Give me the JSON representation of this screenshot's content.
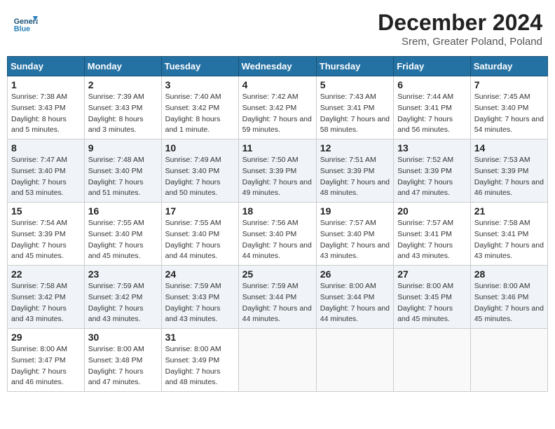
{
  "header": {
    "logo_general": "General",
    "logo_blue": "Blue",
    "month_title": "December 2024",
    "location": "Srem, Greater Poland, Poland"
  },
  "calendar": {
    "days_of_week": [
      "Sunday",
      "Monday",
      "Tuesday",
      "Wednesday",
      "Thursday",
      "Friday",
      "Saturday"
    ],
    "weeks": [
      [
        {
          "day": "1",
          "sunrise": "7:38 AM",
          "sunset": "3:43 PM",
          "daylight": "8 hours and 5 minutes."
        },
        {
          "day": "2",
          "sunrise": "7:39 AM",
          "sunset": "3:43 PM",
          "daylight": "8 hours and 3 minutes."
        },
        {
          "day": "3",
          "sunrise": "7:40 AM",
          "sunset": "3:42 PM",
          "daylight": "8 hours and 1 minute."
        },
        {
          "day": "4",
          "sunrise": "7:42 AM",
          "sunset": "3:42 PM",
          "daylight": "7 hours and 59 minutes."
        },
        {
          "day": "5",
          "sunrise": "7:43 AM",
          "sunset": "3:41 PM",
          "daylight": "7 hours and 58 minutes."
        },
        {
          "day": "6",
          "sunrise": "7:44 AM",
          "sunset": "3:41 PM",
          "daylight": "7 hours and 56 minutes."
        },
        {
          "day": "7",
          "sunrise": "7:45 AM",
          "sunset": "3:40 PM",
          "daylight": "7 hours and 54 minutes."
        }
      ],
      [
        {
          "day": "8",
          "sunrise": "7:47 AM",
          "sunset": "3:40 PM",
          "daylight": "7 hours and 53 minutes."
        },
        {
          "day": "9",
          "sunrise": "7:48 AM",
          "sunset": "3:40 PM",
          "daylight": "7 hours and 51 minutes."
        },
        {
          "day": "10",
          "sunrise": "7:49 AM",
          "sunset": "3:40 PM",
          "daylight": "7 hours and 50 minutes."
        },
        {
          "day": "11",
          "sunrise": "7:50 AM",
          "sunset": "3:39 PM",
          "daylight": "7 hours and 49 minutes."
        },
        {
          "day": "12",
          "sunrise": "7:51 AM",
          "sunset": "3:39 PM",
          "daylight": "7 hours and 48 minutes."
        },
        {
          "day": "13",
          "sunrise": "7:52 AM",
          "sunset": "3:39 PM",
          "daylight": "7 hours and 47 minutes."
        },
        {
          "day": "14",
          "sunrise": "7:53 AM",
          "sunset": "3:39 PM",
          "daylight": "7 hours and 46 minutes."
        }
      ],
      [
        {
          "day": "15",
          "sunrise": "7:54 AM",
          "sunset": "3:39 PM",
          "daylight": "7 hours and 45 minutes."
        },
        {
          "day": "16",
          "sunrise": "7:55 AM",
          "sunset": "3:40 PM",
          "daylight": "7 hours and 45 minutes."
        },
        {
          "day": "17",
          "sunrise": "7:55 AM",
          "sunset": "3:40 PM",
          "daylight": "7 hours and 44 minutes."
        },
        {
          "day": "18",
          "sunrise": "7:56 AM",
          "sunset": "3:40 PM",
          "daylight": "7 hours and 44 minutes."
        },
        {
          "day": "19",
          "sunrise": "7:57 AM",
          "sunset": "3:40 PM",
          "daylight": "7 hours and 43 minutes."
        },
        {
          "day": "20",
          "sunrise": "7:57 AM",
          "sunset": "3:41 PM",
          "daylight": "7 hours and 43 minutes."
        },
        {
          "day": "21",
          "sunrise": "7:58 AM",
          "sunset": "3:41 PM",
          "daylight": "7 hours and 43 minutes."
        }
      ],
      [
        {
          "day": "22",
          "sunrise": "7:58 AM",
          "sunset": "3:42 PM",
          "daylight": "7 hours and 43 minutes."
        },
        {
          "day": "23",
          "sunrise": "7:59 AM",
          "sunset": "3:42 PM",
          "daylight": "7 hours and 43 minutes."
        },
        {
          "day": "24",
          "sunrise": "7:59 AM",
          "sunset": "3:43 PM",
          "daylight": "7 hours and 43 minutes."
        },
        {
          "day": "25",
          "sunrise": "7:59 AM",
          "sunset": "3:44 PM",
          "daylight": "7 hours and 44 minutes."
        },
        {
          "day": "26",
          "sunrise": "8:00 AM",
          "sunset": "3:44 PM",
          "daylight": "7 hours and 44 minutes."
        },
        {
          "day": "27",
          "sunrise": "8:00 AM",
          "sunset": "3:45 PM",
          "daylight": "7 hours and 45 minutes."
        },
        {
          "day": "28",
          "sunrise": "8:00 AM",
          "sunset": "3:46 PM",
          "daylight": "7 hours and 45 minutes."
        }
      ],
      [
        {
          "day": "29",
          "sunrise": "8:00 AM",
          "sunset": "3:47 PM",
          "daylight": "7 hours and 46 minutes."
        },
        {
          "day": "30",
          "sunrise": "8:00 AM",
          "sunset": "3:48 PM",
          "daylight": "7 hours and 47 minutes."
        },
        {
          "day": "31",
          "sunrise": "8:00 AM",
          "sunset": "3:49 PM",
          "daylight": "7 hours and 48 minutes."
        },
        null,
        null,
        null,
        null
      ]
    ]
  }
}
